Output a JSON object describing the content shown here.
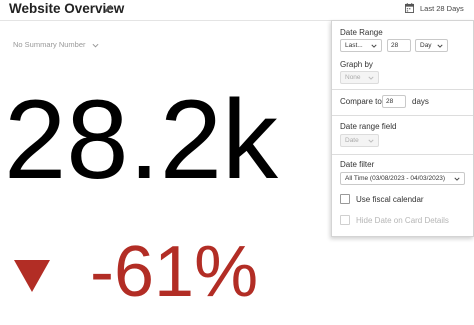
{
  "header": {
    "title": "Website Overview",
    "date_button_label": "Last 28 Days"
  },
  "summary_select": {
    "value": "No Summary Number"
  },
  "kpi": {
    "value": "28.2k",
    "change": "-61%",
    "change_color": "#b22d25",
    "direction": "down"
  },
  "panel": {
    "date_range": {
      "label": "Date Range",
      "unit_value": "Last...",
      "count_value": "28",
      "period_value": "Day"
    },
    "graph_by": {
      "label": "Graph by",
      "value": "None"
    },
    "compare": {
      "label_prefix": "Compare to",
      "value": "28",
      "label_suffix": "days"
    },
    "date_range_field": {
      "label": "Date range field",
      "value": "Date"
    },
    "date_filter": {
      "label": "Date filter",
      "value": "All Time (03/08/2023 - 04/03/2023)",
      "fiscal_label": "Use fiscal calendar",
      "hide_label": "Hide Date on Card Details"
    }
  },
  "icons": {
    "edit": "pencil-icon",
    "calendar": "calendar-icon",
    "trend": "triangle-down-icon",
    "dropdown": "chevron-down-icon"
  }
}
